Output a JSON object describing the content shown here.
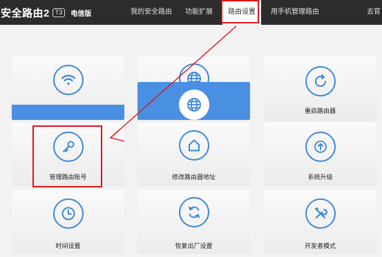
{
  "header": {
    "brand": "安全路由2",
    "brand_badge": "T3",
    "edition": "电信版",
    "nav": [
      "我的安全路由",
      "功能扩展",
      "路由设置",
      "用手机管理路由",
      "去官"
    ],
    "active_nav": "路由设置"
  },
  "tiles": {
    "reboot": "重启路由器",
    "account": "管理路由账号",
    "address": "修改路由器地址",
    "upgrade": "系统升级",
    "time": "时间设置",
    "factory": "恢复出厂设置",
    "developer": "开发者模式"
  },
  "colors": {
    "topbar": "#2c2c2c",
    "accent": "#3b87d9",
    "selected_tile": "#4a90e2",
    "annotation": "#e0101a"
  },
  "icons": {
    "wifi": "wifi-icon",
    "globe": "globe-icon",
    "reboot": "refresh-icon",
    "key": "key-icon",
    "home": "home-icon",
    "upgrade": "arrow-up-icon",
    "clock": "clock-icon",
    "reset": "reset-icon",
    "tools": "tools-icon"
  }
}
